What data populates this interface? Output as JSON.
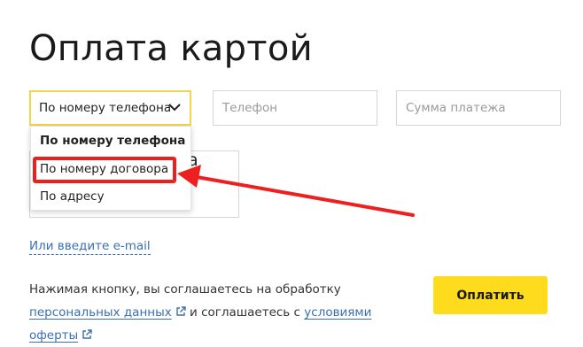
{
  "page_title": "Оплата картой",
  "method_select": {
    "selected": "По номеру телефона",
    "options": [
      "По номеру телефона",
      "По номеру договора",
      "По адресу"
    ]
  },
  "phone_field": {
    "placeholder": "Телефон",
    "value": ""
  },
  "amount_field": {
    "placeholder": "Сумма платежа",
    "value": ""
  },
  "hidden_field_peek": "а",
  "email_link": "Или введите e-mail",
  "consent": {
    "before": "Нажимая кнопку, вы соглашаетесь на обработку ",
    "link1": "персональных данных",
    "middle": " и соглашаетесь с ",
    "link2": "условиями оферты"
  },
  "pay_button": "Оплатить",
  "colors": {
    "accent_yellow": "#ffdb1e",
    "link_blue": "#3a6fb3",
    "annotation_red": "#ee1f1f",
    "select_border": "#f2d64b"
  }
}
